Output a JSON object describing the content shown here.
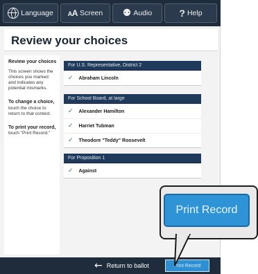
{
  "topbar": {
    "language_label": "Language",
    "screen_label": "Screen",
    "screen_glyph_small": "A",
    "screen_glyph_large": "A",
    "audio_label": "Audio",
    "help_label": "Help",
    "help_glyph": "?"
  },
  "page_title": "Review your choices",
  "sidebar": {
    "heading": "Review your choices",
    "description": "This screen shows the choices you marked and indicates any potential mismarks.",
    "change_heading": "To change a choice,",
    "change_text": "touch the choice to return to that contest.",
    "print_heading": "To print your record,",
    "print_text": "touch \"Print Record.\""
  },
  "contests": [
    {
      "title": "For U.S. Representative, District 2",
      "choices": [
        "Abraham Lincoln"
      ]
    },
    {
      "title": "For School Board, at large",
      "choices": [
        "Alexander Hamilton",
        "Harriet Tubman",
        "Theodore \"Teddy\" Roosevelt"
      ]
    },
    {
      "title": "For Proposition 1",
      "choices": [
        "Against"
      ]
    }
  ],
  "bottombar": {
    "return_label": "Return to ballot",
    "print_small_label": "Print Record"
  },
  "callout": {
    "print_label": "Print Record"
  },
  "colors": {
    "bar": "#1e2c3c",
    "contest_header": "#1f3a5a",
    "print_button": "#2f94d6",
    "check": "#2d7a3e"
  },
  "icons": {
    "language": "globe-icon",
    "audio": "ear-icon",
    "help": "question-icon",
    "check": "check-icon",
    "return": "arrow-left-icon"
  }
}
